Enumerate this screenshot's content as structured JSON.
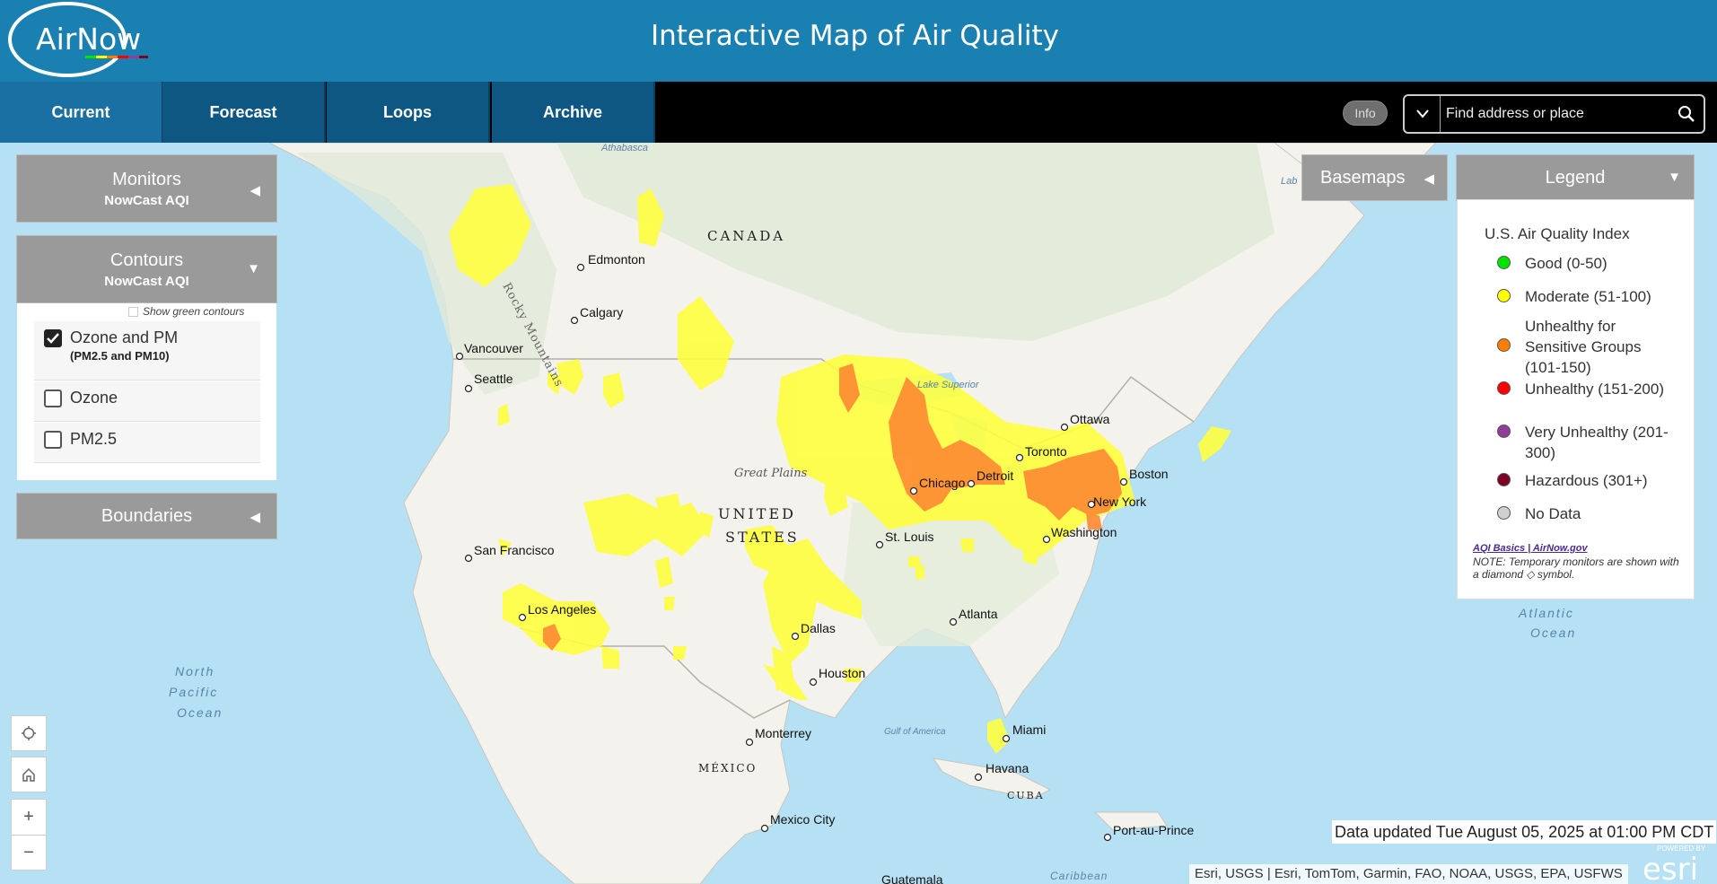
{
  "header": {
    "logo_text": "AirNow",
    "title": "Interactive Map of Air Quality"
  },
  "nav": {
    "tabs": [
      {
        "label": "Current",
        "active": true
      },
      {
        "label": "Forecast"
      },
      {
        "label": "Loops"
      },
      {
        "label": "Archive"
      }
    ]
  },
  "toolbar": {
    "info_label": "Info",
    "search_placeholder": "Find address or place"
  },
  "panels": {
    "monitors": {
      "title": "Monitors",
      "subtitle": "NowCast AQI"
    },
    "contours": {
      "title": "Contours",
      "subtitle": "NowCast AQI",
      "show_green_label": "Show green contours",
      "options": [
        {
          "label": "Ozone and PM",
          "sublabel": "(PM2.5 and PM10)",
          "checked": true
        },
        {
          "label": "Ozone",
          "checked": false
        },
        {
          "label": "PM2.5",
          "checked": false
        }
      ]
    },
    "boundaries": {
      "title": "Boundaries"
    },
    "basemaps": {
      "title": "Basemaps"
    },
    "legend": {
      "title": "Legend",
      "heading": "U.S. Air Quality Index",
      "items": [
        {
          "label": "Good (0-50)",
          "color": "#00e400"
        },
        {
          "label": "Moderate (51-100)",
          "color": "#ffff00"
        },
        {
          "label": "Unhealthy for Sensitive Groups (101-150)",
          "color": "#ff7e00"
        },
        {
          "label": "Unhealthy (151-200)",
          "color": "#ff0000"
        },
        {
          "label": "Very Unhealthy (201-300)",
          "color": "#8f3f97"
        },
        {
          "label": "Hazardous (301+)",
          "color": "#7e0023"
        },
        {
          "label": "No Data",
          "color": "#d0d0d0"
        }
      ],
      "link_text": "AQI Basics | AirNow.gov",
      "note": "NOTE: Temporary monitors are shown with a diamond ◇ symbol."
    }
  },
  "map": {
    "countries": [
      "CANADA",
      "UNITED",
      "STATES",
      "MÉXICO",
      "CUBA"
    ],
    "cities": [
      "Edmonton",
      "Calgary",
      "Vancouver",
      "Seattle",
      "San Francisco",
      "Los Angeles",
      "Dallas",
      "Houston",
      "Monterrey",
      "Mexico City",
      "St. Louis",
      "Chicago",
      "Detroit",
      "Toronto",
      "Ottawa",
      "Boston",
      "New York",
      "Washington",
      "Atlanta",
      "Miami",
      "Havana",
      "Port-au-Prince",
      "Guatemala"
    ],
    "features": [
      "Athabasca",
      "Rocky Mountains",
      "Great Plains",
      "Lake Superior",
      "Gulf of America",
      "Lab",
      "Caribbean"
    ],
    "oceans": {
      "pacific": [
        "North",
        "Pacific",
        "Ocean"
      ],
      "atlantic": [
        "Atlantic",
        "Ocean"
      ]
    }
  },
  "footer": {
    "data_updated": "Data updated Tue August 05, 2025 at 01:00 PM CDT",
    "attribution": "Esri, USGS | Esri, TomTom, Garmin, FAO, NOAA, USGS, EPA, USFWS",
    "esri_powered": "POWERED BY",
    "esri_logo": "esri"
  },
  "colors": {
    "header": "#1a7fb1",
    "nav_tab": "#0f5783",
    "land": "#f3f2ed",
    "water": "#b6e0f3",
    "moderate": "#ffff3a",
    "usg": "#ff8a33"
  }
}
